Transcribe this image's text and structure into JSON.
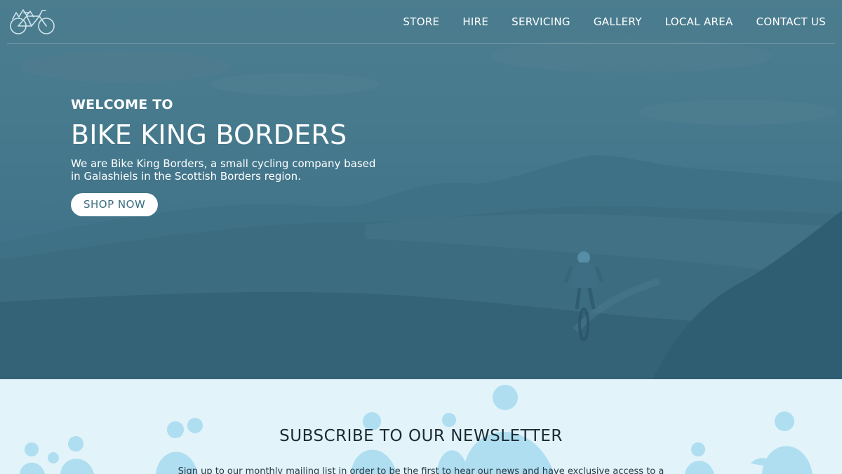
{
  "nav": {
    "items": [
      "STORE",
      "HIRE",
      "SERVICING",
      "GALLERY",
      "LOCAL AREA",
      "CONTACT US"
    ]
  },
  "hero": {
    "eyebrow": "WELCOME TO",
    "title": "BIKE KING BORDERS",
    "description": "We are Bike King Borders, a small cycling company based in Galashiels in the Scottish Borders region.",
    "cta_label": "SHOP NOW"
  },
  "newsletter": {
    "title": "SUBSCRIBE TO OUR NEWSLETTER",
    "text": "Sign up to our monthly mailing list in order to be the first to hear our news and have exclusive access to a"
  },
  "colors": {
    "hero_overlay": "#477a8d",
    "newsletter_bg": "#e2f3fa",
    "button_text": "#3a6d80"
  }
}
